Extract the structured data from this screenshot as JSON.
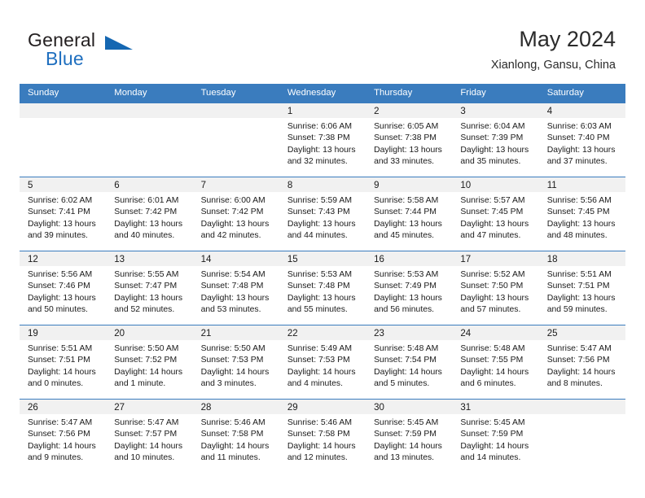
{
  "brand": {
    "word_one": "General",
    "word_two": "Blue",
    "flag_icon": "triangle-flag-icon",
    "accent_color": "#1567b2"
  },
  "header": {
    "title": "May 2024",
    "location": "Xianlong, Gansu, China"
  },
  "calendar": {
    "header_color": "#3a7cbe",
    "daynum_band_color": "#f1f1f1",
    "weekdays": [
      "Sunday",
      "Monday",
      "Tuesday",
      "Wednesday",
      "Thursday",
      "Friday",
      "Saturday"
    ],
    "weeks": [
      [
        {
          "day": "",
          "sunrise": "",
          "sunset": "",
          "daylight_line1": "",
          "daylight_line2": ""
        },
        {
          "day": "",
          "sunrise": "",
          "sunset": "",
          "daylight_line1": "",
          "daylight_line2": ""
        },
        {
          "day": "",
          "sunrise": "",
          "sunset": "",
          "daylight_line1": "",
          "daylight_line2": ""
        },
        {
          "day": "1",
          "sunrise": "Sunrise: 6:06 AM",
          "sunset": "Sunset: 7:38 PM",
          "daylight_line1": "Daylight: 13 hours",
          "daylight_line2": "and 32 minutes."
        },
        {
          "day": "2",
          "sunrise": "Sunrise: 6:05 AM",
          "sunset": "Sunset: 7:38 PM",
          "daylight_line1": "Daylight: 13 hours",
          "daylight_line2": "and 33 minutes."
        },
        {
          "day": "3",
          "sunrise": "Sunrise: 6:04 AM",
          "sunset": "Sunset: 7:39 PM",
          "daylight_line1": "Daylight: 13 hours",
          "daylight_line2": "and 35 minutes."
        },
        {
          "day": "4",
          "sunrise": "Sunrise: 6:03 AM",
          "sunset": "Sunset: 7:40 PM",
          "daylight_line1": "Daylight: 13 hours",
          "daylight_line2": "and 37 minutes."
        }
      ],
      [
        {
          "day": "5",
          "sunrise": "Sunrise: 6:02 AM",
          "sunset": "Sunset: 7:41 PM",
          "daylight_line1": "Daylight: 13 hours",
          "daylight_line2": "and 39 minutes."
        },
        {
          "day": "6",
          "sunrise": "Sunrise: 6:01 AM",
          "sunset": "Sunset: 7:42 PM",
          "daylight_line1": "Daylight: 13 hours",
          "daylight_line2": "and 40 minutes."
        },
        {
          "day": "7",
          "sunrise": "Sunrise: 6:00 AM",
          "sunset": "Sunset: 7:42 PM",
          "daylight_line1": "Daylight: 13 hours",
          "daylight_line2": "and 42 minutes."
        },
        {
          "day": "8",
          "sunrise": "Sunrise: 5:59 AM",
          "sunset": "Sunset: 7:43 PM",
          "daylight_line1": "Daylight: 13 hours",
          "daylight_line2": "and 44 minutes."
        },
        {
          "day": "9",
          "sunrise": "Sunrise: 5:58 AM",
          "sunset": "Sunset: 7:44 PM",
          "daylight_line1": "Daylight: 13 hours",
          "daylight_line2": "and 45 minutes."
        },
        {
          "day": "10",
          "sunrise": "Sunrise: 5:57 AM",
          "sunset": "Sunset: 7:45 PM",
          "daylight_line1": "Daylight: 13 hours",
          "daylight_line2": "and 47 minutes."
        },
        {
          "day": "11",
          "sunrise": "Sunrise: 5:56 AM",
          "sunset": "Sunset: 7:45 PM",
          "daylight_line1": "Daylight: 13 hours",
          "daylight_line2": "and 48 minutes."
        }
      ],
      [
        {
          "day": "12",
          "sunrise": "Sunrise: 5:56 AM",
          "sunset": "Sunset: 7:46 PM",
          "daylight_line1": "Daylight: 13 hours",
          "daylight_line2": "and 50 minutes."
        },
        {
          "day": "13",
          "sunrise": "Sunrise: 5:55 AM",
          "sunset": "Sunset: 7:47 PM",
          "daylight_line1": "Daylight: 13 hours",
          "daylight_line2": "and 52 minutes."
        },
        {
          "day": "14",
          "sunrise": "Sunrise: 5:54 AM",
          "sunset": "Sunset: 7:48 PM",
          "daylight_line1": "Daylight: 13 hours",
          "daylight_line2": "and 53 minutes."
        },
        {
          "day": "15",
          "sunrise": "Sunrise: 5:53 AM",
          "sunset": "Sunset: 7:48 PM",
          "daylight_line1": "Daylight: 13 hours",
          "daylight_line2": "and 55 minutes."
        },
        {
          "day": "16",
          "sunrise": "Sunrise: 5:53 AM",
          "sunset": "Sunset: 7:49 PM",
          "daylight_line1": "Daylight: 13 hours",
          "daylight_line2": "and 56 minutes."
        },
        {
          "day": "17",
          "sunrise": "Sunrise: 5:52 AM",
          "sunset": "Sunset: 7:50 PM",
          "daylight_line1": "Daylight: 13 hours",
          "daylight_line2": "and 57 minutes."
        },
        {
          "day": "18",
          "sunrise": "Sunrise: 5:51 AM",
          "sunset": "Sunset: 7:51 PM",
          "daylight_line1": "Daylight: 13 hours",
          "daylight_line2": "and 59 minutes."
        }
      ],
      [
        {
          "day": "19",
          "sunrise": "Sunrise: 5:51 AM",
          "sunset": "Sunset: 7:51 PM",
          "daylight_line1": "Daylight: 14 hours",
          "daylight_line2": "and 0 minutes."
        },
        {
          "day": "20",
          "sunrise": "Sunrise: 5:50 AM",
          "sunset": "Sunset: 7:52 PM",
          "daylight_line1": "Daylight: 14 hours",
          "daylight_line2": "and 1 minute."
        },
        {
          "day": "21",
          "sunrise": "Sunrise: 5:50 AM",
          "sunset": "Sunset: 7:53 PM",
          "daylight_line1": "Daylight: 14 hours",
          "daylight_line2": "and 3 minutes."
        },
        {
          "day": "22",
          "sunrise": "Sunrise: 5:49 AM",
          "sunset": "Sunset: 7:53 PM",
          "daylight_line1": "Daylight: 14 hours",
          "daylight_line2": "and 4 minutes."
        },
        {
          "day": "23",
          "sunrise": "Sunrise: 5:48 AM",
          "sunset": "Sunset: 7:54 PM",
          "daylight_line1": "Daylight: 14 hours",
          "daylight_line2": "and 5 minutes."
        },
        {
          "day": "24",
          "sunrise": "Sunrise: 5:48 AM",
          "sunset": "Sunset: 7:55 PM",
          "daylight_line1": "Daylight: 14 hours",
          "daylight_line2": "and 6 minutes."
        },
        {
          "day": "25",
          "sunrise": "Sunrise: 5:47 AM",
          "sunset": "Sunset: 7:56 PM",
          "daylight_line1": "Daylight: 14 hours",
          "daylight_line2": "and 8 minutes."
        }
      ],
      [
        {
          "day": "26",
          "sunrise": "Sunrise: 5:47 AM",
          "sunset": "Sunset: 7:56 PM",
          "daylight_line1": "Daylight: 14 hours",
          "daylight_line2": "and 9 minutes."
        },
        {
          "day": "27",
          "sunrise": "Sunrise: 5:47 AM",
          "sunset": "Sunset: 7:57 PM",
          "daylight_line1": "Daylight: 14 hours",
          "daylight_line2": "and 10 minutes."
        },
        {
          "day": "28",
          "sunrise": "Sunrise: 5:46 AM",
          "sunset": "Sunset: 7:58 PM",
          "daylight_line1": "Daylight: 14 hours",
          "daylight_line2": "and 11 minutes."
        },
        {
          "day": "29",
          "sunrise": "Sunrise: 5:46 AM",
          "sunset": "Sunset: 7:58 PM",
          "daylight_line1": "Daylight: 14 hours",
          "daylight_line2": "and 12 minutes."
        },
        {
          "day": "30",
          "sunrise": "Sunrise: 5:45 AM",
          "sunset": "Sunset: 7:59 PM",
          "daylight_line1": "Daylight: 14 hours",
          "daylight_line2": "and 13 minutes."
        },
        {
          "day": "31",
          "sunrise": "Sunrise: 5:45 AM",
          "sunset": "Sunset: 7:59 PM",
          "daylight_line1": "Daylight: 14 hours",
          "daylight_line2": "and 14 minutes."
        },
        {
          "day": "",
          "sunrise": "",
          "sunset": "",
          "daylight_line1": "",
          "daylight_line2": ""
        }
      ]
    ]
  }
}
